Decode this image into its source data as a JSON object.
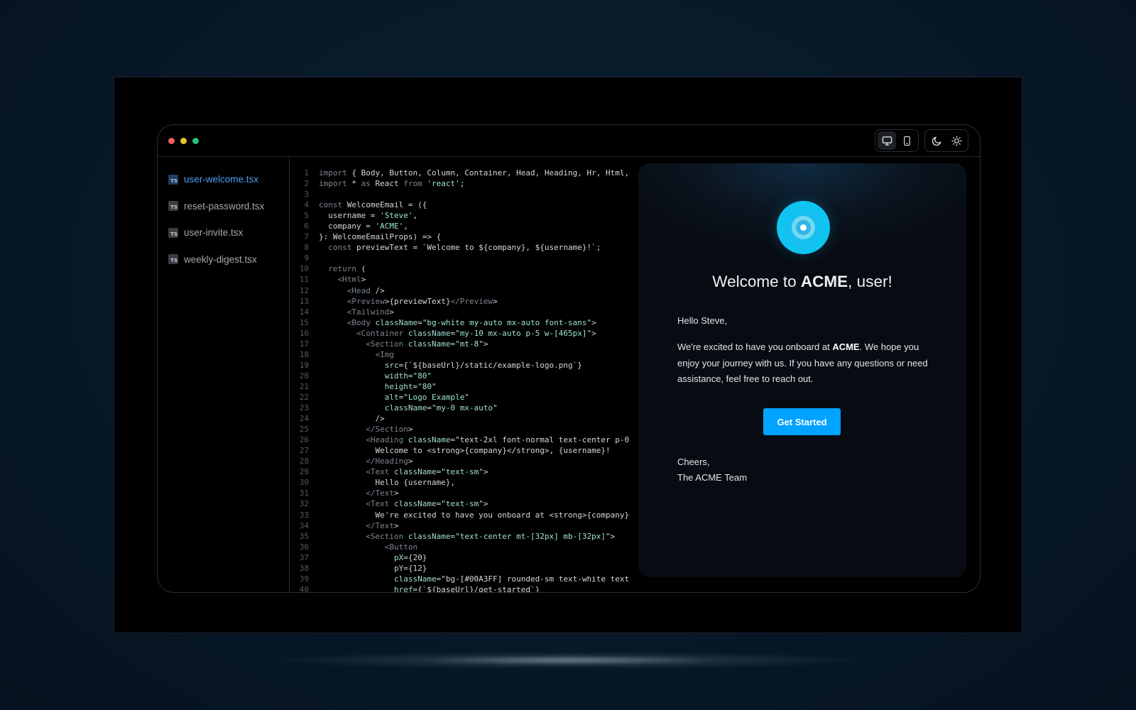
{
  "sidebar": {
    "files": [
      {
        "badge": "TS",
        "label": "user-welcome.tsx",
        "active": true
      },
      {
        "badge": "TS",
        "label": "reset-password.tsx",
        "active": false
      },
      {
        "badge": "TS",
        "label": "user-invite.tsx",
        "active": false
      },
      {
        "badge": "TS",
        "label": "weekly-digest.tsx",
        "active": false
      }
    ]
  },
  "toolbar": {
    "view_buttons": [
      {
        "icon": "desktop-icon",
        "active": true
      },
      {
        "icon": "mobile-icon",
        "active": false
      }
    ],
    "theme_buttons": [
      {
        "icon": "moon-icon",
        "active": false
      },
      {
        "icon": "sun-icon",
        "active": false
      }
    ]
  },
  "code": {
    "lines": [
      "import { Body, Button, Column, Container, Head, Heading, Hr, Html,",
      "import * as React from 'react';",
      "",
      "const WelcomeEmail = ({",
      "  username = 'Steve',",
      "  company = 'ACME',",
      "}: WelcomeEmailProps) => {",
      "  const previewText = `Welcome to ${company}, ${username}!`;",
      "",
      "  return (",
      "    <Html>",
      "      <Head />",
      "      <Preview>{previewText}</Preview>",
      "      <Tailwind>",
      "      <Body className=\"bg-white my-auto mx-auto font-sans\">",
      "        <Container className=\"my-10 mx-auto p-5 w-[465px]\">",
      "          <Section className=\"mt-8\">",
      "            <Img",
      "              src={`${baseUrl}/static/example-logo.png`}",
      "              width=\"80\"",
      "              height=\"80\"",
      "              alt=\"Logo Example\"",
      "              className=\"my-0 mx-auto\"",
      "            />",
      "          </Section>",
      "          <Heading className=\"text-2xl font-normal text-center p-0",
      "            Welcome to <strong>{company}</strong>, {username}!",
      "          </Heading>",
      "          <Text className=\"text-sm\">",
      "            Hello {username},",
      "          </Text>",
      "          <Text className=\"text-sm\">",
      "            We're excited to have you onboard at <strong>{company}</",
      "          </Text>",
      "          <Section className=\"text-center mt-[32px] mb-[32px]\">",
      "              <Button",
      "                pX={20}",
      "                pY={12}",
      "                className=\"bg-[#00A3FF] rounded-sm text-white text",
      "                href={`${baseUrl}/get-started`}"
    ]
  },
  "preview": {
    "heading_prefix": "Welcome to ",
    "heading_company": "ACME",
    "heading_suffix": ", user!",
    "greeting": "Hello Steve,",
    "body_prefix": "We're excited to have you onboard at ",
    "body_company": "ACME",
    "body_suffix": ". We hope you enjoy your journey with us. If you have any questions or need assistance, feel free to reach out.",
    "button_label": "Get Started",
    "signoff": "Cheers,",
    "signature": "The ACME Team"
  },
  "colors": {
    "accent": "#00A3FF",
    "active_file": "#4f9cf0"
  }
}
